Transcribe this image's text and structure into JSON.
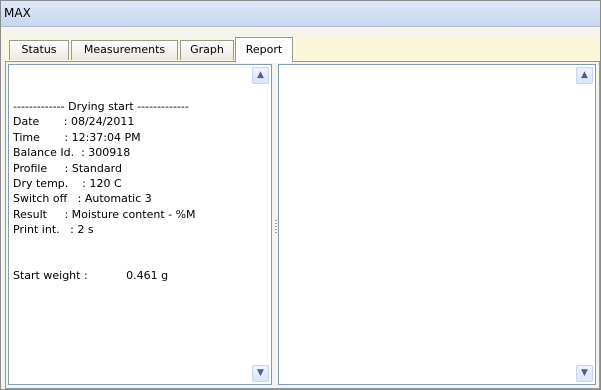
{
  "window": {
    "title": "MAX"
  },
  "tabs": [
    {
      "label": "Status"
    },
    {
      "label": "Measurements"
    },
    {
      "label": "Graph"
    },
    {
      "label": "Report"
    }
  ],
  "report": {
    "lines": [
      "------------- Drying start -------------",
      "Date       : 08/24/2011",
      "Time       : 12:37:04 PM",
      "Balance Id.  : 300918",
      "Profile     : Standard",
      "Dry temp.    : 120 C",
      "Switch off   : Automatic 3",
      "Result     : Moisture content - %M",
      "Print int.   : 2 s",
      "",
      "",
      "Start weight :           0.461 g"
    ]
  },
  "icons": {
    "scroll_up": "chevron-up-icon",
    "scroll_down": "chevron-down-icon",
    "splitter_grip": "grip-icon"
  }
}
